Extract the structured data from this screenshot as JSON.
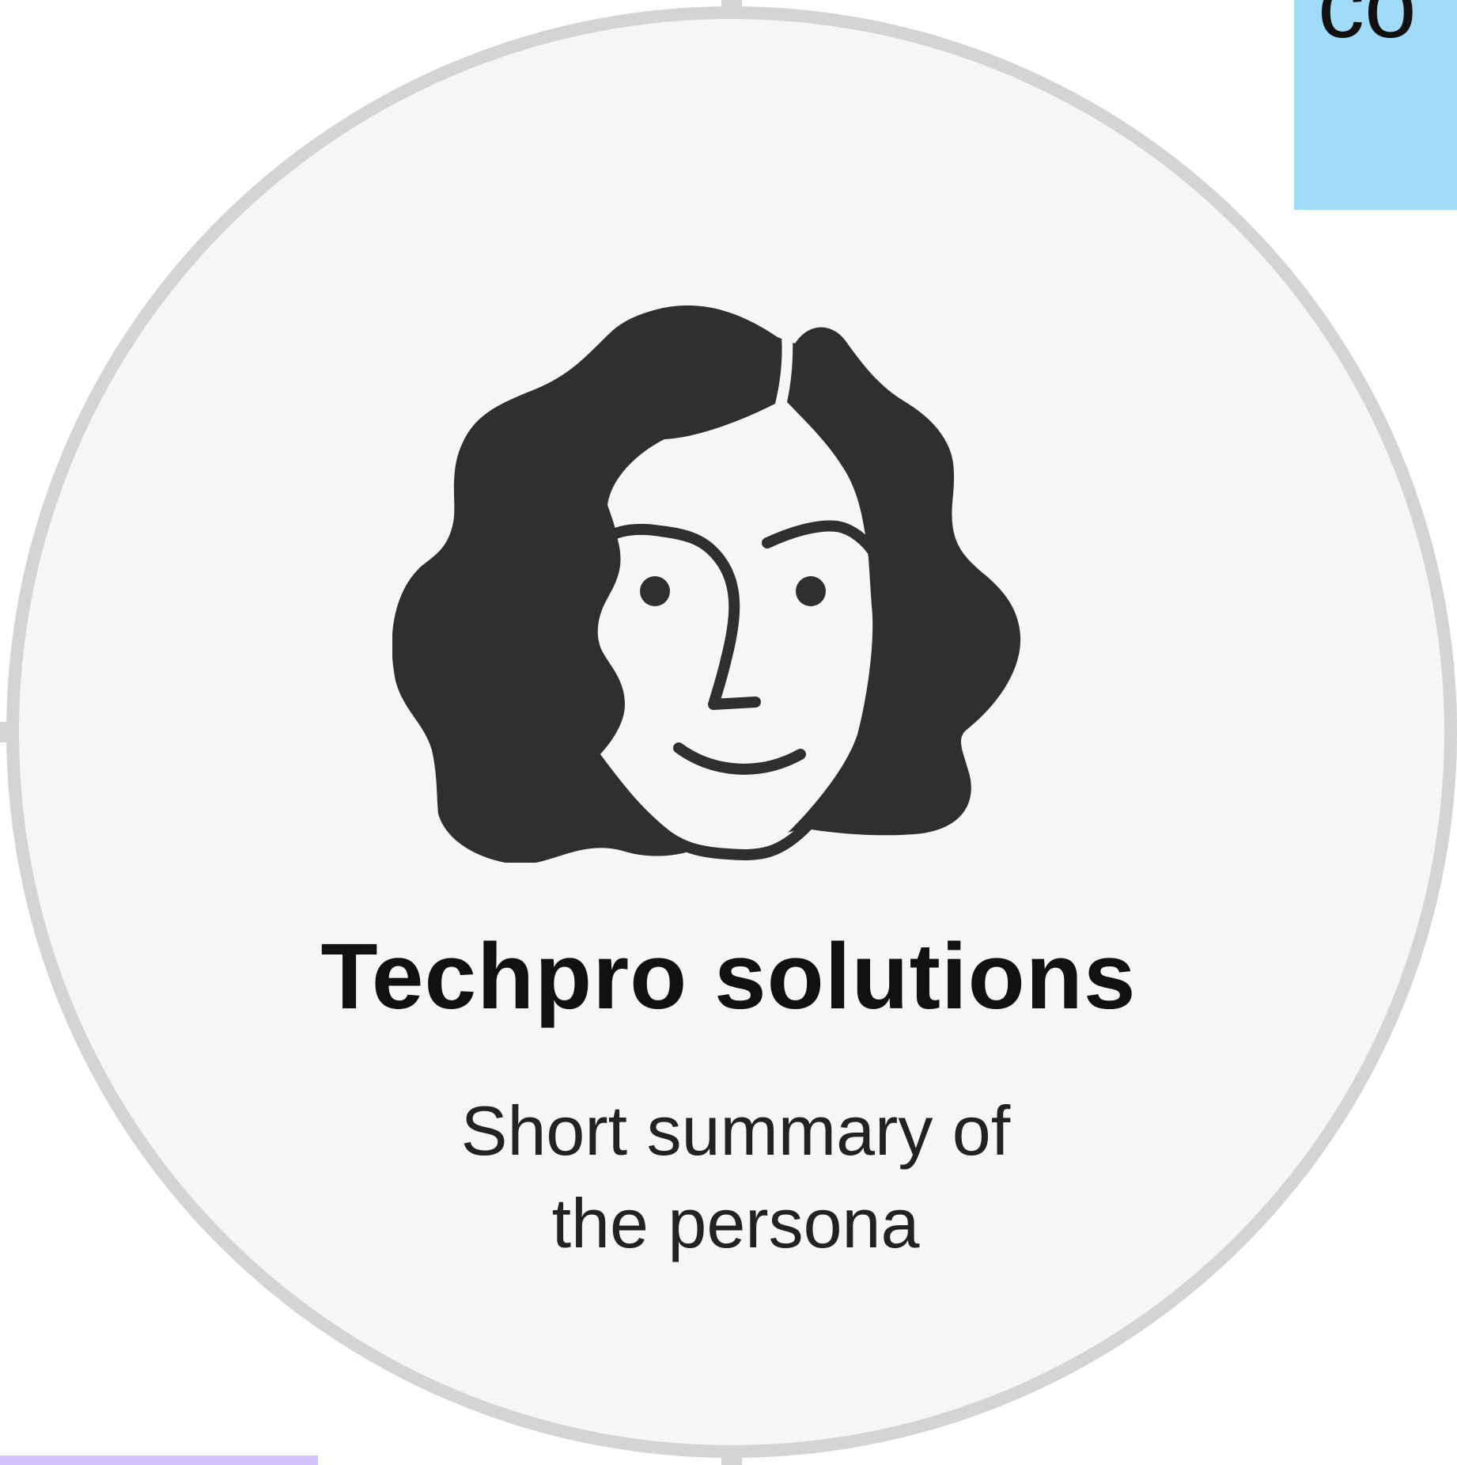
{
  "colors": {
    "circle_fill": "#f6f6f6",
    "circle_border": "#d4d4d4",
    "hair": "#2f2f2f",
    "face_line": "#2f2f2f",
    "sticky_blue": "#a0dbf7",
    "sticky_purple": "#d2c3fc"
  },
  "sticky_note": {
    "text": "co"
  },
  "persona": {
    "icon": "woman-face-icon",
    "name": "Techpro solutions",
    "summary": "Short summary of the persona"
  }
}
